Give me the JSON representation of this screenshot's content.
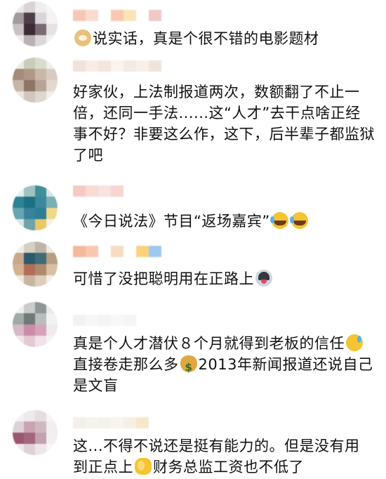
{
  "comments": [
    {
      "avatar_colors": [
        "#eceae7",
        "#d8d4d3",
        "#f0eeed",
        "#f6f5f4",
        "#a39a9e",
        "#4f3d48",
        "#d9d4d6",
        "#f4f2f2",
        "#c9c2c5",
        "#3d2a35",
        "#7a6a72",
        "#e6e2e3",
        "#ece9ea",
        "#b9b0b4",
        "#dcd7d9",
        "#f3f1f1"
      ],
      "name_colors": [
        "#f6c7b6",
        "#f7dccf",
        "#ffffff",
        "#f9c8b1",
        "#fbe4b9",
        "#ffffff",
        "#f0c8c4"
      ],
      "text": "说实话，真是个很不错的电影题材",
      "emojis": [
        "doge"
      ]
    },
    {
      "avatar_colors": [
        "#e9ece4",
        "#c7cdb8",
        "#d7dccd",
        "#eef0ea",
        "#a58b7b",
        "#b19786",
        "#c9b7a8",
        "#d8ccc2",
        "#c5b6a9",
        "#8e7565",
        "#b7a497",
        "#e2d8d0",
        "#eae6e1",
        "#d1c6bd",
        "#ded6cf",
        "#f1eeeb"
      ],
      "name_colors": [
        "#f1e3da",
        "#f8ece6",
        "#f4e5dd",
        "#fbf3ee",
        "#f2eae4",
        "#f8efe9",
        "#f0e3da"
      ],
      "text": "好家伙，上法制报道两次，数额翻了不止一倍，还同一手法......这“人才”去干点啥正经事不好？非要这么作，这下，后半辈子都监狱了吧",
      "emojis": []
    },
    {
      "avatar_colors": [
        "#e7f0ee",
        "#9ec3c1",
        "#3d8f98",
        "#d5e6e4",
        "#2e8393",
        "#1e6f83",
        "#3a88a0",
        "#7ab0b3",
        "#66a5b0",
        "#38839b",
        "#2b7f96",
        "#f2d98a",
        "#d8e7e6",
        "#6ea3ad",
        "#e9c866",
        "#f7f1e2"
      ],
      "name_colors": [
        "#f4c9c1",
        "#f7dbd4",
        "#f9e3de",
        "#f6d6cf",
        "#ffffff",
        "#ffffff",
        "#ffffff"
      ],
      "text": "《今日说法》节目“返场嘉宾”",
      "emojis": [
        "laugh-cry",
        "laugh-cry"
      ]
    },
    {
      "avatar_colors": [
        "#f0eeea",
        "#d6cfc4",
        "#bfb5a6",
        "#ece8e1",
        "#c9a88c",
        "#2b5a6a",
        "#3e6c78",
        "#b79d84",
        "#d1b391",
        "#b56c57",
        "#ad8a6b",
        "#d9c0a4",
        "#eee7de",
        "#c8b5a0",
        "#ddcdb9",
        "#f3eee8"
      ],
      "name_colors": [
        "#f4b89b",
        "#f7c8ae",
        "#ffffff",
        "#f7dcc3",
        "#ffffff",
        "#fbd27c",
        "#9ec8ef"
      ],
      "text": "可惜了没把聪明用在正路上",
      "emojis": [
        "husky"
      ]
    },
    {
      "avatar_colors": [
        "#eeeeee",
        "#c9cccb",
        "#8d9694",
        "#e8eae9",
        "#a0aaa7",
        "#6f7a78",
        "#b7bebc",
        "#f1f2f2",
        "#d8b9c6",
        "#c98da8",
        "#d7a3b9",
        "#f2e9ed",
        "#efe6ea",
        "#e3c9d4",
        "#f0e2e8",
        "#f7f3f5"
      ],
      "name_colors": [
        "#f2f2f2",
        "#f7f7f7",
        "#f4f4f4",
        "#f8f8f8",
        "#f5f5f5",
        "#ffffff",
        "#ffffff"
      ],
      "text": "真是个人才潜伏８个月就得到老板的信任",
      "text2": "直接卷走那么多",
      "text3": "2013年新闻报道还说自己是文盲",
      "emojis": [
        "sweat",
        "money-bag"
      ]
    },
    {
      "avatar_colors": [
        "#f3f1f1",
        "#eee9ea",
        "#e5dde0",
        "#f5f3f4",
        "#ddd3d7",
        "#c9a3b3",
        "#d0b8c1",
        "#f2eef0",
        "#9b566f",
        "#a3667c",
        "#c4a1ae",
        "#f3eff1",
        "#efe9ec",
        "#e0d1d7",
        "#eee7ea",
        "#f8f6f7"
      ],
      "name_colors": [
        "#f3efe9",
        "#f6f2ec",
        "#f4f0ea",
        "#f8f4ee",
        "#f6efe6",
        "#f7e8c9",
        "#ffffff"
      ],
      "text": "这...不得不说还是挺有能力的。但是没有用到正点上",
      "text2": "财务总监工资也不低了",
      "emojis": [
        "clap"
      ]
    }
  ]
}
